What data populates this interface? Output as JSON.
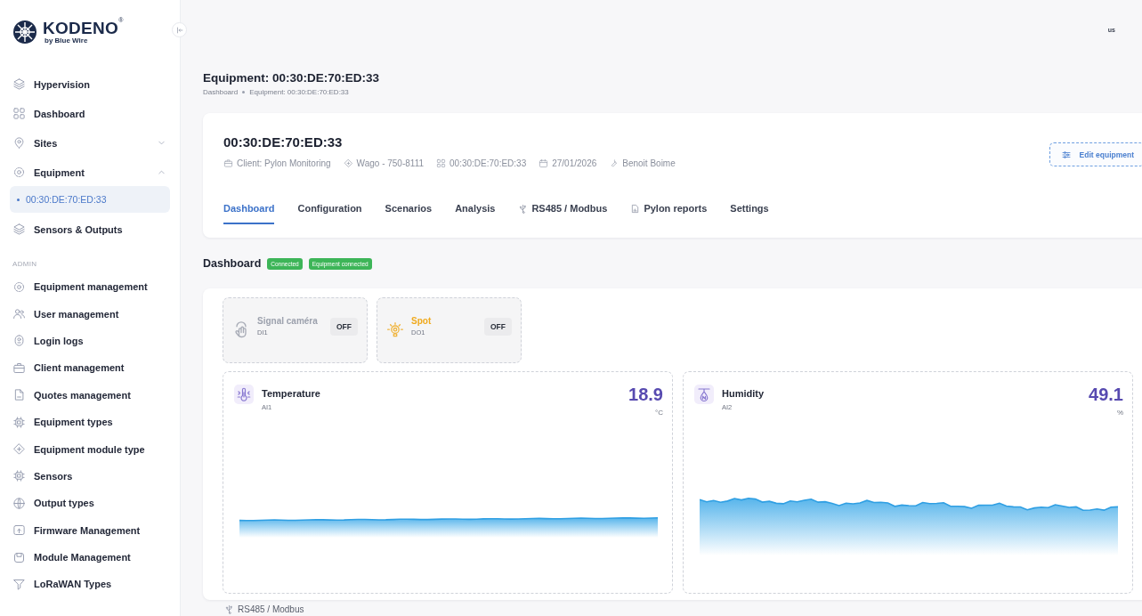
{
  "logo": {
    "brand": "KODENO",
    "registered": "®",
    "tagline": "by Blue Wire"
  },
  "top_bar": {
    "user": "us"
  },
  "sidebar": {
    "items": [
      {
        "label": "Hypervision",
        "selected": false
      },
      {
        "label": "Dashboard",
        "selected": false
      },
      {
        "label": "Sites",
        "selected": false,
        "expanded": false
      },
      {
        "label": "Equipment",
        "selected": false,
        "expanded": true,
        "children": [
          {
            "label": "00:30:DE:70:ED:33",
            "selected": true
          }
        ]
      },
      {
        "label": "Sensors & Outputs",
        "selected": false
      }
    ],
    "admin": {
      "title": "ADMIN",
      "items": [
        {
          "label": "Equipment management",
          "selected": false
        },
        {
          "label": "User management",
          "selected": false
        },
        {
          "label": "Login logs",
          "selected": false
        },
        {
          "label": "Client management",
          "selected": false
        },
        {
          "label": "Quotes management",
          "selected": false
        },
        {
          "label": "Equipment types",
          "selected": false
        },
        {
          "label": "Equipment module type",
          "selected": false
        },
        {
          "label": "Sensors",
          "selected": false
        },
        {
          "label": "Output types",
          "selected": false
        },
        {
          "label": "Firmware Management",
          "selected": false
        },
        {
          "label": "Module Management",
          "selected": false
        },
        {
          "label": "LoRaWAN Types",
          "selected": false
        }
      ]
    }
  },
  "page": {
    "title": "Equipment: 00:30:DE:70:ED:33",
    "breadcrumb": [
      "Dashboard",
      "Equipment: 00:30:DE:70:ED:33"
    ]
  },
  "equipment_card": {
    "title": "00:30:DE:70:ED:33",
    "meta": [
      {
        "kind": "client",
        "text": "Client: Pylon Monitoring"
      },
      {
        "kind": "model",
        "text": "Wago - 750-8111"
      },
      {
        "kind": "mac",
        "text": "00:30:DE:70:ED:33"
      },
      {
        "kind": "date",
        "text": "27/01/2026"
      },
      {
        "kind": "user",
        "text": "Benoit Boime"
      }
    ],
    "edit_button": "Edit equipment",
    "tabs": [
      {
        "label": "Dashboard",
        "kind": "plain",
        "selected": true
      },
      {
        "label": "Configuration",
        "kind": "plain",
        "selected": false
      },
      {
        "label": "Scenarios",
        "kind": "plain",
        "selected": false
      },
      {
        "label": "Analysis",
        "kind": "plain",
        "selected": false
      },
      {
        "label": "RS485 / Modbus",
        "kind": "usb",
        "selected": false
      },
      {
        "label": "Pylon reports",
        "kind": "report",
        "selected": false
      },
      {
        "label": "Settings",
        "kind": "plain",
        "selected": false
      }
    ]
  },
  "dashboard": {
    "title": "Dashboard",
    "badges": [
      "Connected",
      "Equipment connected"
    ],
    "outputs": [
      {
        "kind": "input",
        "name": "Signal caméra",
        "code": "DI1",
        "state": "OFF"
      },
      {
        "kind": "output",
        "name": "Spot",
        "code": "DO1",
        "state": "OFF"
      }
    ],
    "sensors": [
      {
        "kind": "temperature",
        "name": "Temperature",
        "code": "AI1",
        "value": "18.9",
        "unit": "°C"
      },
      {
        "kind": "humidity",
        "name": "Humidity",
        "code": "AI2",
        "value": "49.1",
        "unit": "%"
      }
    ]
  },
  "next_section": {
    "title": "RS485 / Modbus"
  }
}
